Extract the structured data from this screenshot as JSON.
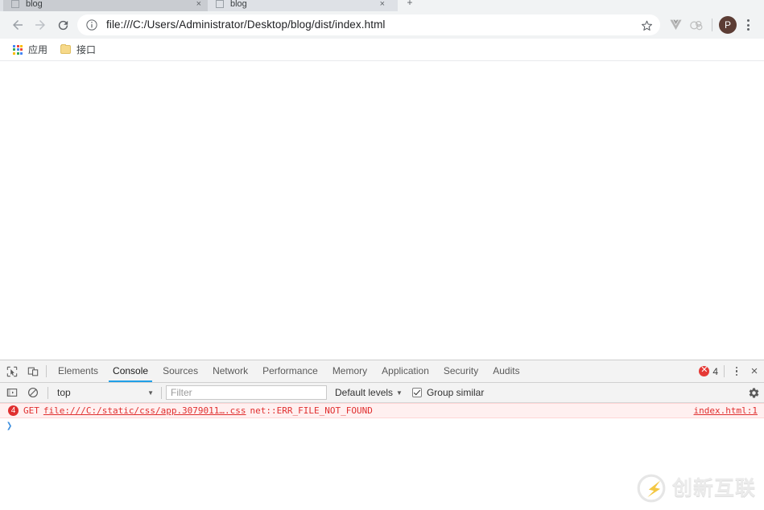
{
  "browser": {
    "tabs": [
      {
        "title": "blog",
        "close_label": "×",
        "active": true
      },
      {
        "title": "blog",
        "close_label": "×",
        "active": false
      }
    ],
    "new_tab_label": "+",
    "toolbar": {
      "back_label": "Back",
      "forward_label": "Forward",
      "reload_label": "Reload",
      "url": "file:///C:/Users/Administrator/Desktop/blog/dist/index.html",
      "star_label": "Bookmark this page",
      "avatar_initial": "P",
      "avatar_color": "#5c3d35",
      "vue_ext_label": "Vue.js devtools",
      "other_ext_label": "Extension",
      "menu_label": "Customize and control Google Chrome"
    },
    "bookmarks": [
      {
        "label": "应用",
        "icon": "apps-grid-icon"
      },
      {
        "label": "接口",
        "icon": "folder-icon"
      }
    ]
  },
  "devtools": {
    "inspect_label": "Inspect element",
    "device_label": "Toggle device toolbar",
    "tabs": [
      {
        "label": "Elements",
        "active": false
      },
      {
        "label": "Console",
        "active": true
      },
      {
        "label": "Sources",
        "active": false
      },
      {
        "label": "Network",
        "active": false
      },
      {
        "label": "Performance",
        "active": false
      },
      {
        "label": "Memory",
        "active": false
      },
      {
        "label": "Application",
        "active": false
      },
      {
        "label": "Security",
        "active": false
      },
      {
        "label": "Audits",
        "active": false
      }
    ],
    "error_count": "4",
    "close_label": "×",
    "filterbar": {
      "sidebar_toggle_label": "Show console sidebar",
      "clear_label": "Clear console",
      "context": "top",
      "context_caret": "▼",
      "filter_placeholder": "Filter",
      "levels": "Default levels",
      "levels_caret": "▼",
      "group_similar": "Group similar",
      "group_similar_checked": true,
      "settings_label": "Console settings"
    },
    "console": {
      "messages": [
        {
          "badge": "4",
          "method": "GET",
          "url": "file:///C:/static/css/app.3079011….css",
          "error": "net::ERR_FILE_NOT_FOUND",
          "source": "index.html:1"
        }
      ],
      "prompt_caret": "❯",
      "prompt_value": ""
    },
    "accent_color": "#20a0e8",
    "error_color": "#e02f2f"
  },
  "watermark": {
    "text": "创新互联",
    "logo_label": "chuangxin-hulian-logo"
  }
}
